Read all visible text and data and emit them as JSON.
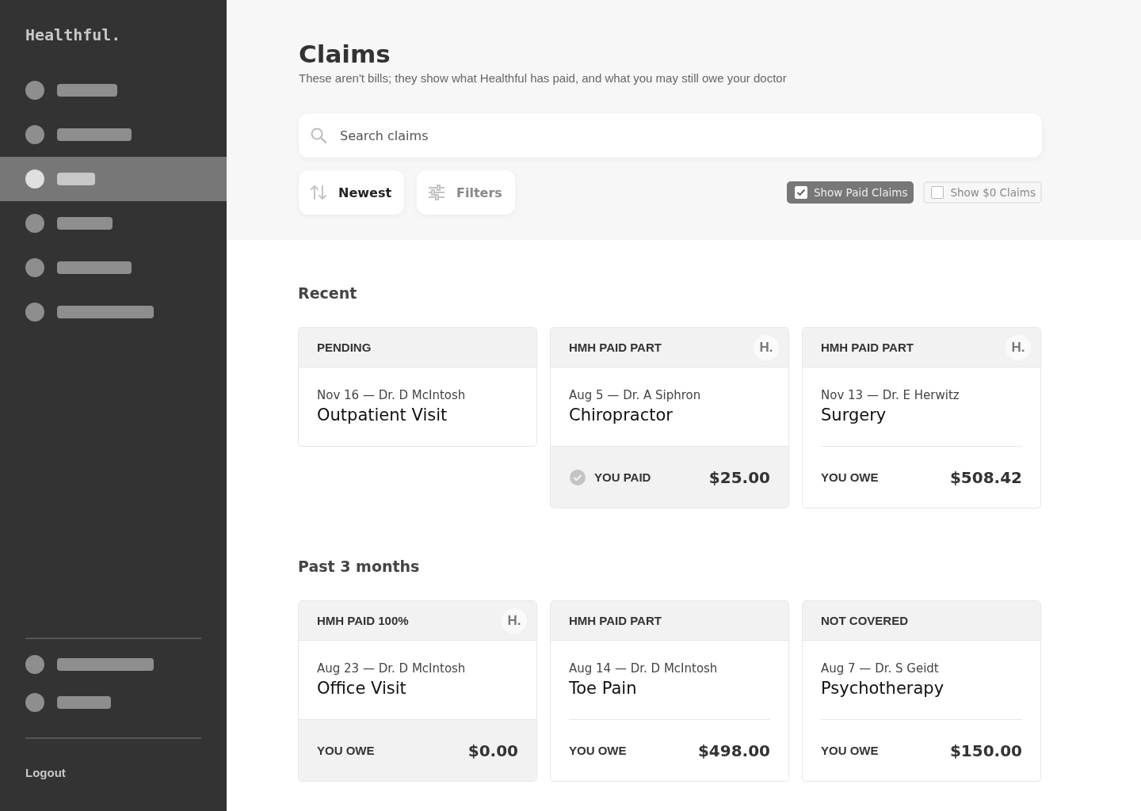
{
  "sidebar": {
    "logo": "Healthful.",
    "items": [
      {
        "selected": false
      },
      {
        "selected": false
      },
      {
        "selected": true
      },
      {
        "selected": false
      },
      {
        "selected": false
      },
      {
        "selected": false
      }
    ],
    "bottom_items": [
      {
        "selected": false
      },
      {
        "selected": false
      }
    ],
    "logout": "Logout"
  },
  "header": {
    "title": "Claims",
    "subtitle": "These aren't bills; they show what Healthful has paid, and what you may still owe your doctor",
    "search": {
      "placeholder": "Search claims"
    },
    "sort_button": "Newest",
    "filters_button": "Filters",
    "toggles": [
      {
        "label": "Show Paid Claims",
        "checked": true
      },
      {
        "label": "Show $0 Claims",
        "checked": false
      }
    ]
  },
  "sections": [
    {
      "title": "Recent",
      "cards": [
        {
          "status": "PENDING",
          "date_doctor": "Nov 16 — Dr. D McIntosh",
          "title": "Outpatient Visit"
        },
        {
          "status": "HMH PAID PART",
          "logo": "H.",
          "date_doctor": "Aug 5 — Dr. A Siphron",
          "title": "Chiropractor",
          "footer": {
            "kind": "paid",
            "shaded": true,
            "label": "YOU PAID",
            "amount": "$25.00"
          }
        },
        {
          "status": "HMH PAID PART",
          "logo": "H.",
          "date_doctor": "Nov 13 — Dr. E Herwitz",
          "title": "Surgery",
          "footer": {
            "kind": "owe",
            "shaded": false,
            "label": "YOU OWE",
            "amount": "$508.42"
          }
        }
      ]
    },
    {
      "title": "Past 3 months",
      "cards": [
        {
          "status": "HMH PAID 100%",
          "logo": "H.",
          "date_doctor": "Aug 23 — Dr. D McIntosh",
          "title": "Office Visit",
          "footer": {
            "kind": "owe",
            "shaded": true,
            "label": "YOU OWE",
            "amount": "$0.00"
          }
        },
        {
          "status": "HMH PAID PART",
          "date_doctor": "Aug 14 — Dr. D McIntosh",
          "title": "Toe Pain",
          "footer": {
            "kind": "owe",
            "shaded": false,
            "label": "YOU OWE",
            "amount": "$498.00"
          }
        },
        {
          "status": "NOT COVERED",
          "date_doctor": "Aug 7 — Dr. S Geidt",
          "title": "Psychotherapy",
          "footer": {
            "kind": "owe",
            "shaded": false,
            "label": "YOU OWE",
            "amount": "$150.00"
          }
        }
      ]
    }
  ]
}
